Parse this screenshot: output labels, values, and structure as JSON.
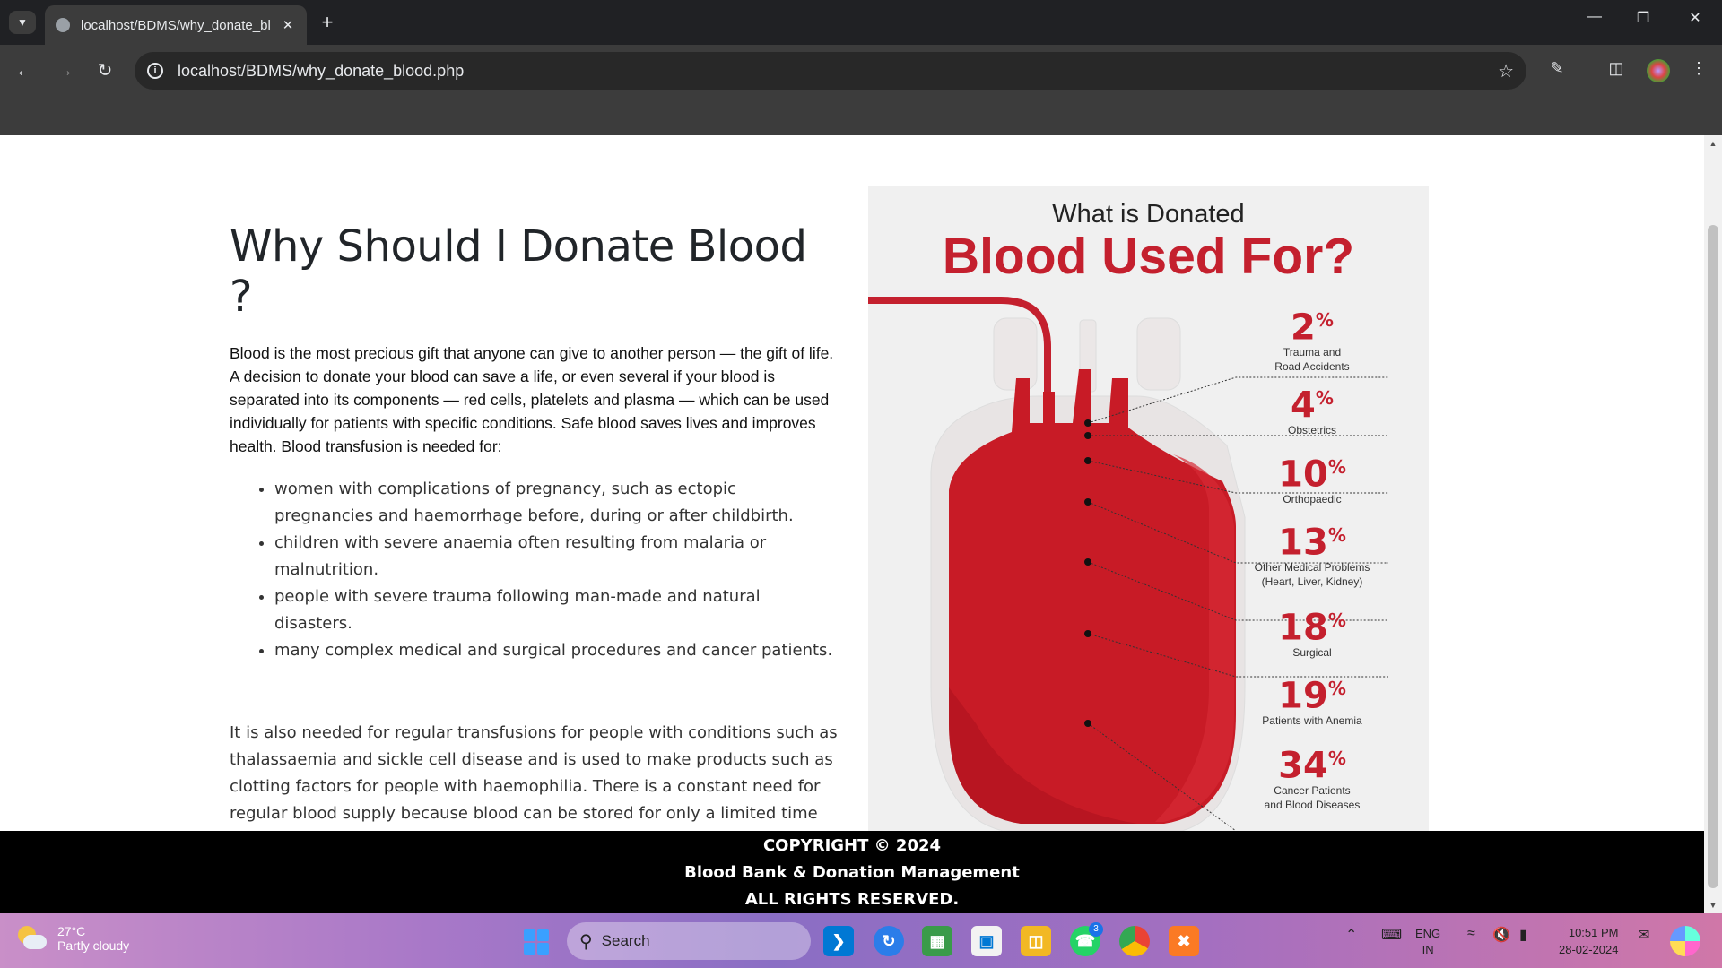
{
  "browser": {
    "tab_title": "localhost/BDMS/why_donate_bl",
    "url": "localhost/BDMS/why_donate_blood.php"
  },
  "page": {
    "title": "Why Should I Donate Blood ?",
    "intro": "Blood is the most precious gift that anyone can give to another person — the gift of life. A decision to donate your blood can save a life, or even several if your blood is separated into its components — red cells, platelets and plasma — which can be used individually for patients with specific conditions. Safe blood saves lives and improves health. Blood transfusion is needed for:",
    "uses": [
      "women with complications of pregnancy, such as ectopic pregnancies and haemorrhage before, during or after childbirth.",
      "children with severe anaemia often resulting from malaria or malnutrition.",
      "people with severe trauma following man-made and natural disasters.",
      "many complex medical and surgical procedures and cancer patients."
    ],
    "outro": "It is also needed for regular transfusions for people with conditions such as thalassaemia and sickle cell disease and is used to make products such as clotting factors for people with haemophilia. There is a constant need for regular blood supply because blood can be stored for only a limited time before use. Regular blood donations by a sufficient number of healthy people are needed to ensure that safe blood will be available whenever and wherever it is needed."
  },
  "infographic": {
    "title_small": "What is Donated",
    "title_big": "Blood Used For?",
    "items": [
      {
        "value": "2",
        "label1": "Trauma and",
        "label2": "Road Accidents"
      },
      {
        "value": "4",
        "label1": "Obstetrics",
        "label2": ""
      },
      {
        "value": "10",
        "label1": "Orthopaedic",
        "label2": ""
      },
      {
        "value": "13",
        "label1": "Other Medical Problems",
        "label2": "(Heart, Liver, Kidney)"
      },
      {
        "value": "18",
        "label1": "Surgical",
        "label2": ""
      },
      {
        "value": "19",
        "label1": "Patients with Anemia",
        "label2": ""
      },
      {
        "value": "34",
        "label1": "Cancer Patients",
        "label2": "and Blood Diseases"
      }
    ],
    "percent_sign": "%",
    "colors": {
      "accent": "#c4202e",
      "bag": "#e8e4e4"
    }
  },
  "footer": {
    "line1": "COPYRIGHT © 2024",
    "line2": "Blood Bank & Donation Management",
    "line3": "ALL RIGHTS RESERVED."
  },
  "taskbar": {
    "temp": "27°C",
    "weather": "Partly cloudy",
    "search_placeholder": "Search",
    "lang1": "ENG",
    "lang2": "IN",
    "time": "10:51 PM",
    "date": "28-02-2024",
    "whatsapp_badge": "3"
  }
}
